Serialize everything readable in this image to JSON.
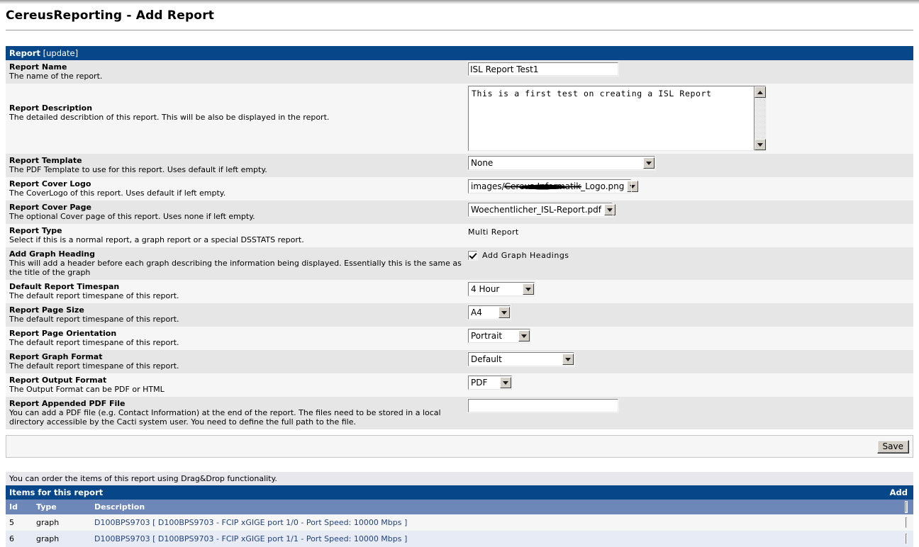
{
  "page": {
    "title": "CereusReporting - Add Report"
  },
  "report_section": {
    "header_bold": "Report",
    "header_normal": " [update]"
  },
  "fields": [
    {
      "name": "Report Name",
      "desc": "The name of the report.",
      "control": "text",
      "value": "ISL Report Test1"
    },
    {
      "name": "Report Description",
      "desc": "The detailed describtion of this report. This will be also be displayed in the report.",
      "control": "textarea",
      "value": "This is a first test on creating a ISL Report"
    },
    {
      "name": "Report Template",
      "desc": "The PDF Template to use for this report. Uses default if left empty.",
      "control": "select",
      "value": "None"
    },
    {
      "name": "Report Cover Logo",
      "desc": "The CoverLogo of this report. Uses default if left empty.",
      "control": "select-redacted",
      "value_prefix": "images/",
      "value_redacted": "Cereus-Informatik",
      "value_suffix": "_Logo.png"
    },
    {
      "name": "Report Cover Page",
      "desc": "The optional Cover page of this report. Uses none if left empty.",
      "control": "select",
      "value": "Woechentlicher_ISL-Report.pdf"
    },
    {
      "name": "Report Type",
      "desc": "Select if this is a normal report, a graph report or a special DSSTATS report.",
      "control": "static",
      "value": "Multi Report"
    },
    {
      "name": "Add Graph Heading",
      "desc": "This will add a header before each graph describing the information being displayed. Essentially this is the same as the title of the graph",
      "control": "checkbox",
      "checked": true,
      "value": "Add Graph Headings"
    },
    {
      "name": "Default Report Timespan",
      "desc": "The default report timespane of this report.",
      "control": "select",
      "value": "4 Hour"
    },
    {
      "name": "Report Page Size",
      "desc": "The default report timespane of this report.",
      "control": "select",
      "value": "A4"
    },
    {
      "name": "Report Page Orientation",
      "desc": "The default report timespane of this report.",
      "control": "select",
      "value": "Portrait"
    },
    {
      "name": "Report Graph Format",
      "desc": "The default report timespane of this report.",
      "control": "select",
      "value": "Default"
    },
    {
      "name": "Report Output Format",
      "desc": "The Output Format can be PDF or HTML",
      "control": "select",
      "value": "PDF"
    },
    {
      "name": "Report Appended PDF File",
      "desc": "You can add a PDF file (e.g. Contact Information) at the end of the report. The files need to be stored in a local directory accessible by the Cacti system user. You need to define the full path to the file.",
      "control": "text",
      "value": ""
    }
  ],
  "save_bar": {
    "save_label": "Save"
  },
  "items_section": {
    "hint": "You can order the items of this report using Drag&Drop functionality.",
    "title": "Items for this report",
    "add_label": "Add",
    "columns": {
      "id": "Id",
      "type": "Type",
      "description": "Description"
    },
    "rows": [
      {
        "id": "5",
        "type": "graph",
        "description": "D100BPS9703 [ D100BPS9703 - FCIP xGIGE port 1/0 - Port Speed: 10000 Mbps ]"
      },
      {
        "id": "6",
        "type": "graph",
        "description": "D100BPS9703 [ D100BPS9703 - FCIP xGIGE port 1/1 - Port Speed: 10000 Mbps ]"
      }
    ]
  },
  "colors": {
    "header_blue": "#08468A",
    "column_blue": "#6D88B8",
    "row_odd": "#F6F6F6",
    "row_even": "#E6E6E6",
    "item_row_even": "#E7EBF6",
    "link_blue": "#21427E"
  }
}
